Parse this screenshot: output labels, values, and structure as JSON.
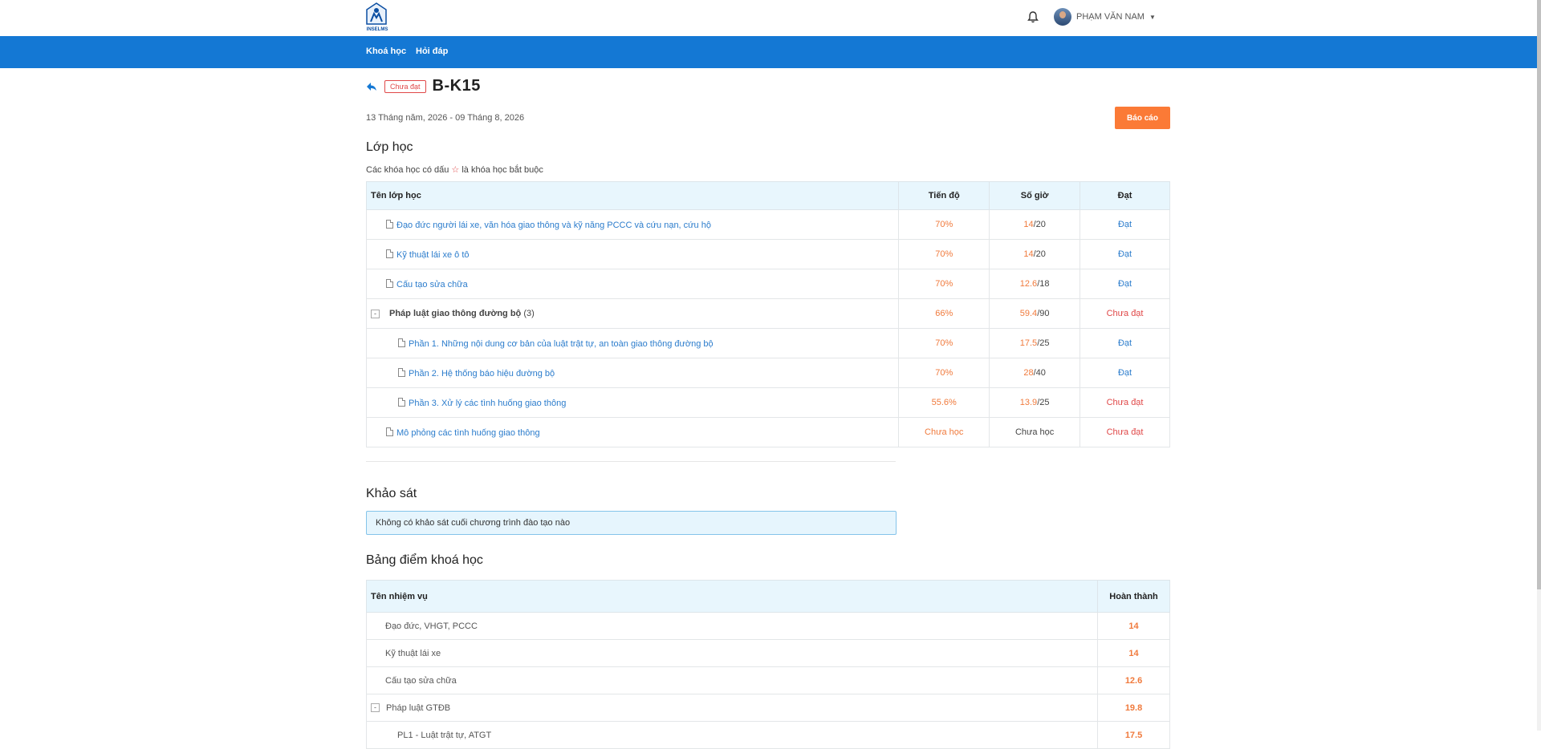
{
  "header": {
    "logo_text": "INSELMS",
    "user_name": "PHẠM VĂN NAM"
  },
  "nav": {
    "items": [
      "Khoá học",
      "Hỏi đáp"
    ]
  },
  "page": {
    "status_badge": "Chưa đạt",
    "title": "B-K15",
    "date_range": "13 Tháng năm, 2026 - 09 Tháng 8, 2026",
    "report_button": "Báo cáo"
  },
  "classes": {
    "section_title": "Lớp học",
    "note_before": "Các khóa học có dấu",
    "note_star": "☆",
    "note_after": "là khóa học bắt buộc",
    "headers": [
      "Tên lớp học",
      "Tiến độ",
      "Số giờ",
      "Đạt"
    ],
    "rows": [
      {
        "name": "Đạo đức người lái xe, văn hóa giao thông và kỹ năng PCCC và cứu nạn, cứu hộ",
        "progress": "70%",
        "hours": "14",
        "total": "/20",
        "status": "Đạt"
      },
      {
        "name": "Kỹ thuật lái xe ô tô",
        "progress": "70%",
        "hours": "14",
        "total": "/20",
        "status": "Đạt"
      },
      {
        "name": "Cấu tạo sửa chữa",
        "progress": "70%",
        "hours": "12.6",
        "total": "/18",
        "status": "Đạt"
      },
      {
        "name": "Pháp luật giao thông đường bộ",
        "count": "(3)",
        "progress": "66%",
        "hours": "59.4",
        "total": "/90",
        "status": "Chưa đạt"
      },
      {
        "name": "Phần 1. Những nội dung cơ bản của luật trật tự, an toàn giao thông đường bộ",
        "progress": "70%",
        "hours": "17.5",
        "total": "/25",
        "status": "Đạt"
      },
      {
        "name": "Phần 2. Hệ thống báo hiệu đường bộ",
        "progress": "70%",
        "hours": "28",
        "total": "/40",
        "status": "Đạt"
      },
      {
        "name": "Phần 3. Xử lý các tình huống giao thông",
        "progress": "55.6%",
        "hours": "13.9",
        "total": "/25",
        "status": "Chưa đạt"
      },
      {
        "name": "Mô phỏng các tình huống giao thông",
        "progress": "Chưa học",
        "hours": "Chưa học",
        "status": "Chưa đạt"
      }
    ]
  },
  "survey": {
    "section_title": "Khảo sát",
    "message": "Không có khảo sát cuối chương trình đào tạo nào"
  },
  "grades": {
    "section_title": "Bảng điểm khoá học",
    "headers": [
      "Tên nhiệm vụ",
      "Hoàn thành"
    ],
    "rows": [
      {
        "name": "Đạo đức, VHGT, PCCC",
        "value": "14"
      },
      {
        "name": "Kỹ thuật lái xe",
        "value": "14"
      },
      {
        "name": "Cấu tạo sửa chữa",
        "value": "12.6"
      },
      {
        "name": "Pháp luật GTĐB",
        "value": "19.8"
      },
      {
        "name": "PL1 - Luật trật tự, ATGT",
        "value": "17.5"
      }
    ]
  },
  "colors": {
    "nav": "#1478d4",
    "accent": "#fb7a36",
    "fail": "#e04848",
    "link": "#2b7ccc"
  }
}
